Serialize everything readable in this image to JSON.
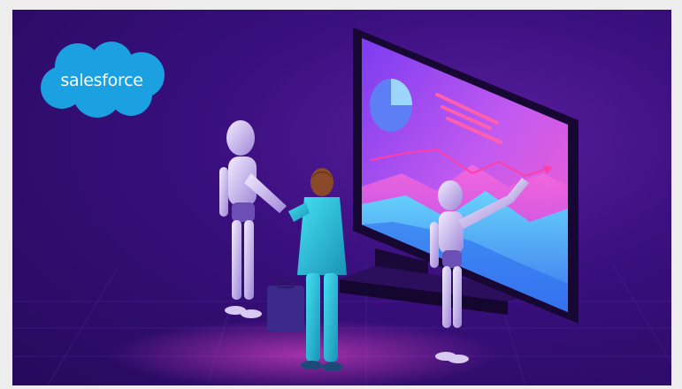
{
  "brand": {
    "logo_text": "salesforce",
    "cloud_color": "#1ba0e1"
  },
  "colors": {
    "background": "#2d0c6c",
    "accent_pink": "#ff4fd8",
    "accent_cyan": "#4ce0f0",
    "screen_frame": "#1b0a3e",
    "robot_body": "#d8c9f2",
    "person_suit": "#2fc3d6"
  },
  "icons": [
    "cloud-logo-icon",
    "pie-chart-icon",
    "trend-arrow-icon",
    "briefcase-icon"
  ]
}
